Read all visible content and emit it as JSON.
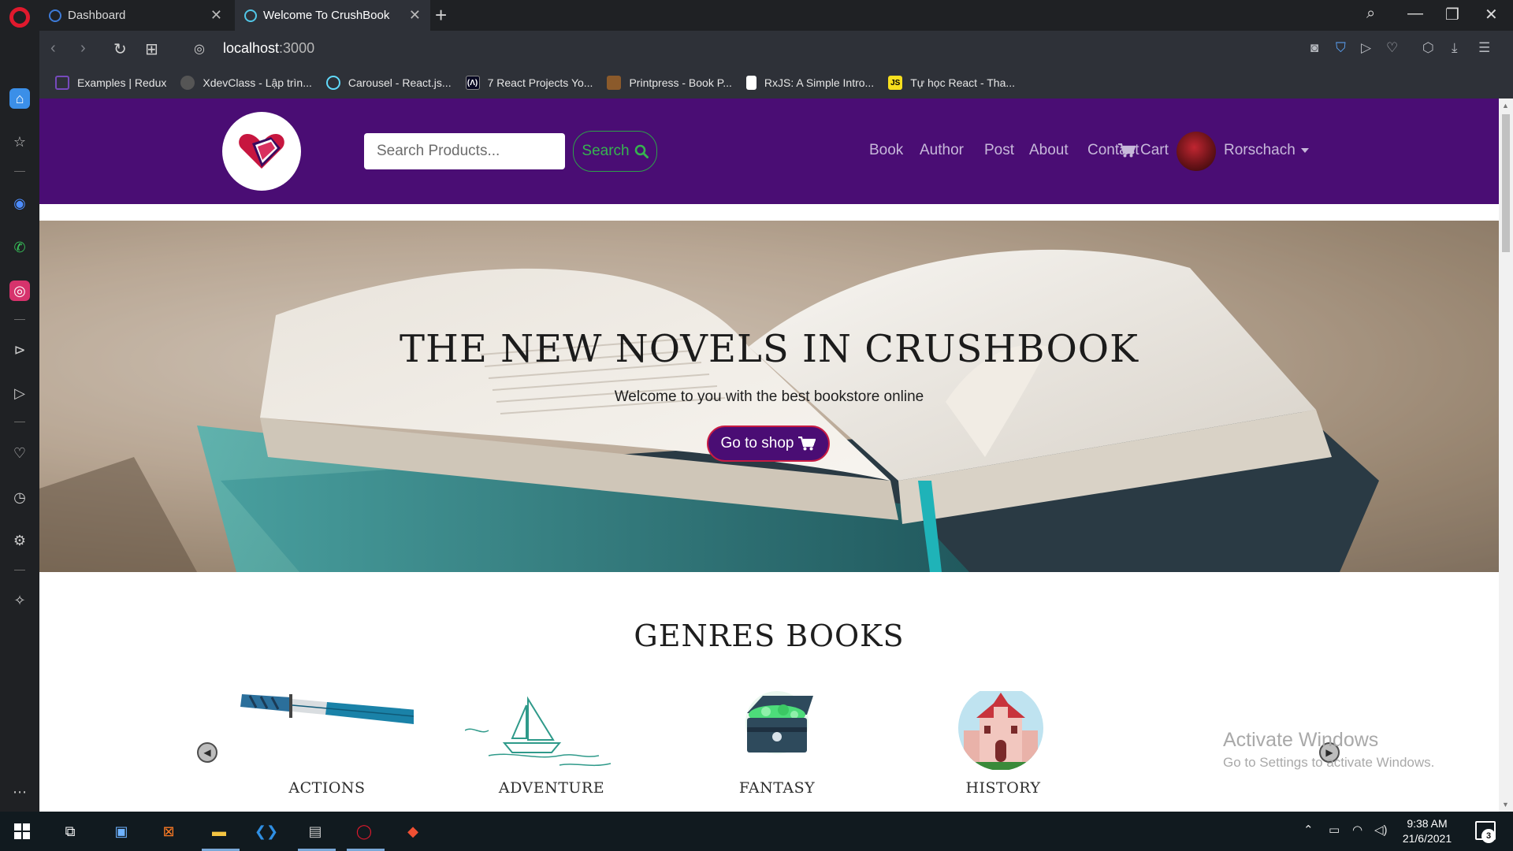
{
  "browser": {
    "tabs": [
      {
        "title": "Dashboard"
      },
      {
        "title": "Welcome To CrushBook"
      }
    ],
    "new_tab_symbol": "+",
    "address": {
      "host": "localhost",
      "port": ":3000"
    },
    "bookmarks": [
      {
        "label": "Examples | Redux",
        "icon": "redux-icon",
        "color": "#764abc"
      },
      {
        "label": "XdevClass - Lập trìn...",
        "icon": "xdevclass-icon",
        "color": "#9a9a9a"
      },
      {
        "label": "Carousel - React.js...",
        "icon": "react-icon",
        "color": "#61dafb"
      },
      {
        "label": "7 React Projects Yo...",
        "icon": "freecodecamp-icon",
        "color": "#0a0a23"
      },
      {
        "label": "Printpress - Book P...",
        "icon": "book-icon",
        "color": "#8b5a2b"
      },
      {
        "label": "RxJS: A Simple Intro...",
        "icon": "document-icon",
        "color": "#ffffff"
      },
      {
        "label": "Tự học React - Tha...",
        "icon": "js-icon",
        "color": "#f7df1e"
      }
    ]
  },
  "site": {
    "search_placeholder": "Search Products...",
    "search_button": "Search",
    "menu": [
      "Book",
      "Author",
      "Post",
      "About",
      "Contact"
    ],
    "cart_label": "Cart",
    "user_name": "Rorschach",
    "hero": {
      "title": "THE NEW NOVELS IN CRUSHBOOK",
      "subtitle": "Welcome to you with the best bookstore online",
      "button": "Go to shop"
    },
    "genres_title": "GENRES BOOKS",
    "genres": [
      {
        "label": "ACTIONS",
        "icon": "sword-icon"
      },
      {
        "label": "ADVENTURE",
        "icon": "sailboat-icon"
      },
      {
        "label": "FANTASY",
        "icon": "treasure-chest-icon"
      },
      {
        "label": "HISTORY",
        "icon": "castle-icon"
      }
    ],
    "colors": {
      "nav_bg": "#4a0d74",
      "search_green": "#36b34f",
      "shop_border": "#c81c43"
    }
  },
  "watermark": {
    "line1": "Activate Windows",
    "line2": "Go to Settings to activate Windows."
  },
  "taskbar": {
    "time": "9:38 AM",
    "date": "21/6/2021",
    "notification_count": "3"
  }
}
